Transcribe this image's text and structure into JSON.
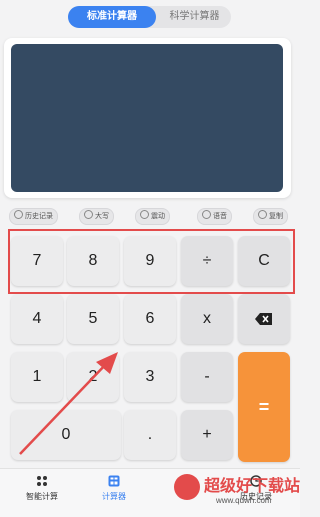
{
  "tabs": {
    "standard": "标准计算器",
    "scientific": "科学计算器"
  },
  "display": {
    "value": ""
  },
  "chips": [
    {
      "label": "历史记录",
      "icon": "history-icon"
    },
    {
      "label": "大写",
      "icon": "uppercase-icon"
    },
    {
      "label": "震动",
      "icon": "vibrate-icon"
    },
    {
      "label": "语音",
      "icon": "speaker-icon"
    },
    {
      "label": "复制",
      "icon": "copy-icon"
    }
  ],
  "keys": {
    "k7": "7",
    "k8": "8",
    "k9": "9",
    "divide": "÷",
    "clear": "C",
    "k4": "4",
    "k5": "5",
    "k6": "6",
    "multiply": "x",
    "k1": "1",
    "k2": "2",
    "k3": "3",
    "minus": "-",
    "k0": "0",
    "dot": ".",
    "plus": "+",
    "equals": "="
  },
  "nav": {
    "smart": "智能计算",
    "calculator": "计算器",
    "history": "历史记录"
  },
  "watermark": {
    "text": "超级好下载站",
    "url": "www.qdwh.com"
  },
  "colors": {
    "accent": "#3b82f0",
    "display": "#344a62",
    "equals": "#f6933a",
    "highlight": "#e34b4b"
  }
}
